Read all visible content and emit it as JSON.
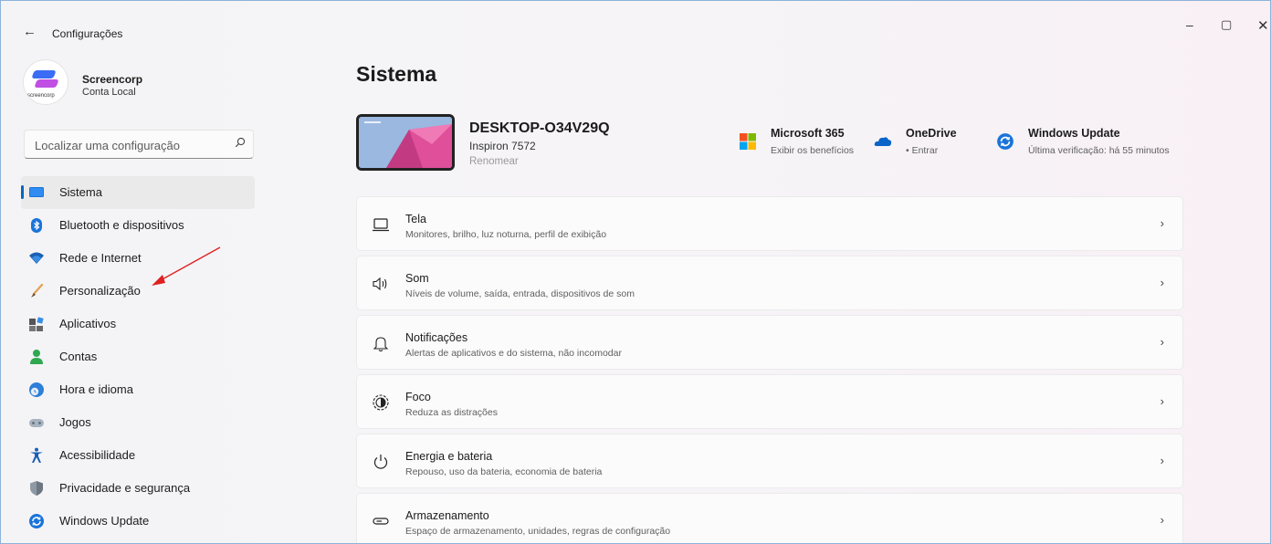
{
  "window": {
    "back_glyph": "←",
    "title": "Configurações",
    "minimize_glyph": "–",
    "maximize_glyph": "▢",
    "close_glyph": "✕"
  },
  "profile": {
    "logo_text": "screencorp",
    "name": "Screencorp",
    "account_type": "Conta Local"
  },
  "search": {
    "placeholder": "Localizar uma configuração",
    "icon": "search-icon"
  },
  "sidebar": {
    "items": [
      {
        "label": "Sistema",
        "icon": "system-icon",
        "active": true
      },
      {
        "label": "Bluetooth e dispositivos",
        "icon": "bluetooth-icon"
      },
      {
        "label": "Rede e Internet",
        "icon": "wifi-icon"
      },
      {
        "label": "Personalização",
        "icon": "brush-icon"
      },
      {
        "label": "Aplicativos",
        "icon": "apps-icon"
      },
      {
        "label": "Contas",
        "icon": "person-icon"
      },
      {
        "label": "Hora e idioma",
        "icon": "globe-clock-icon"
      },
      {
        "label": "Jogos",
        "icon": "gamepad-icon"
      },
      {
        "label": "Acessibilidade",
        "icon": "accessibility-icon"
      },
      {
        "label": "Privacidade e segurança",
        "icon": "shield-icon"
      },
      {
        "label": "Windows Update",
        "icon": "update-icon"
      }
    ]
  },
  "main": {
    "title": "Sistema",
    "device": {
      "name": "DESKTOP-O34V29Q",
      "model": "Inspiron 7572",
      "rename": "Renomear"
    },
    "quick_links": [
      {
        "title": "Microsoft 365",
        "subtitle": "Exibir os benefícios",
        "icon": "microsoft365-icon"
      },
      {
        "title": "OneDrive",
        "subtitle": "• Entrar",
        "icon": "onedrive-icon"
      },
      {
        "title": "Windows Update",
        "subtitle": "Última verificação: há 55 minutos",
        "icon": "update-icon"
      }
    ],
    "cards": [
      {
        "title": "Tela",
        "subtitle": "Monitores, brilho, luz noturna, perfil de exibição",
        "icon": "display-icon"
      },
      {
        "title": "Som",
        "subtitle": "Níveis de volume, saída, entrada, dispositivos de som",
        "icon": "speaker-icon"
      },
      {
        "title": "Notificações",
        "subtitle": "Alertas de aplicativos e do sistema, não incomodar",
        "icon": "bell-icon"
      },
      {
        "title": "Foco",
        "subtitle": "Reduza as distrações",
        "icon": "focus-icon"
      },
      {
        "title": "Energia e bateria",
        "subtitle": "Repouso, uso da bateria, economia de bateria",
        "icon": "power-icon"
      },
      {
        "title": "Armazenamento",
        "subtitle": "Espaço de armazenamento, unidades, regras de configuração",
        "icon": "storage-icon"
      }
    ],
    "chevron": "›"
  },
  "colors": {
    "accent": "#0067c0",
    "annotation_arrow": "#e02020"
  }
}
